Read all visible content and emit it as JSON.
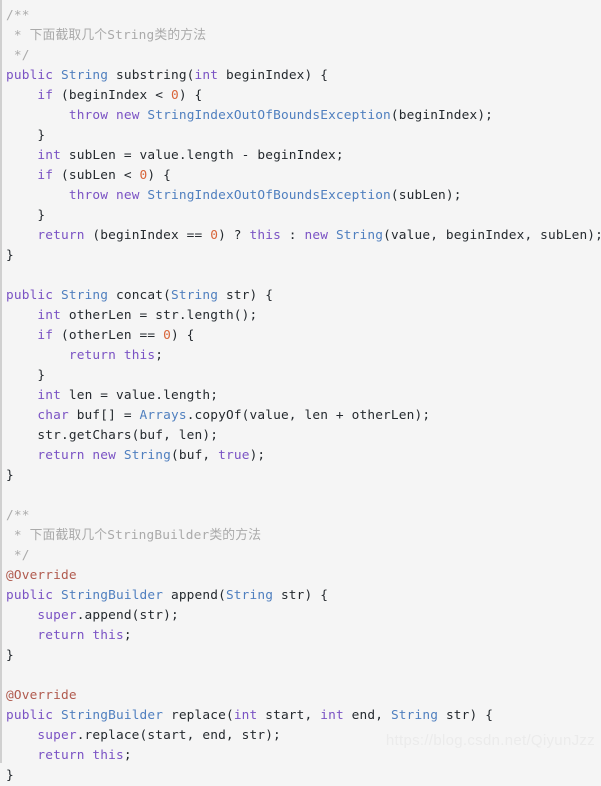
{
  "editor": {
    "language": "java",
    "background_color": "#f5f5f5",
    "colors": {
      "keyword": "#7a52c4",
      "type": "#4f7fbf",
      "annotation": "#b05a4e",
      "number": "#d8653a",
      "comment": "#aaaaaa",
      "plain": "#24292e"
    },
    "lines": [
      {
        "indent": 0,
        "tokens": [
          {
            "t": "/**",
            "c": "cmt"
          }
        ]
      },
      {
        "indent": 0,
        "tokens": [
          {
            "t": " * 下面截取几个String类的方法",
            "c": "cmt"
          }
        ]
      },
      {
        "indent": 0,
        "tokens": [
          {
            "t": " */",
            "c": "cmt"
          }
        ]
      },
      {
        "indent": 0,
        "tokens": [
          {
            "t": "public",
            "c": "kw"
          },
          {
            "t": " ",
            "c": "plain"
          },
          {
            "t": "String",
            "c": "type"
          },
          {
            "t": " substring(",
            "c": "plain"
          },
          {
            "t": "int",
            "c": "kw"
          },
          {
            "t": " beginIndex) {",
            "c": "plain"
          }
        ]
      },
      {
        "indent": 1,
        "tokens": [
          {
            "t": "if",
            "c": "kw"
          },
          {
            "t": " (beginIndex < ",
            "c": "plain"
          },
          {
            "t": "0",
            "c": "num"
          },
          {
            "t": ") {",
            "c": "plain"
          }
        ]
      },
      {
        "indent": 2,
        "tokens": [
          {
            "t": "throw",
            "c": "kw"
          },
          {
            "t": " ",
            "c": "plain"
          },
          {
            "t": "new",
            "c": "kw"
          },
          {
            "t": " ",
            "c": "plain"
          },
          {
            "t": "StringIndexOutOfBoundsException",
            "c": "type"
          },
          {
            "t": "(beginIndex);",
            "c": "plain"
          }
        ]
      },
      {
        "indent": 1,
        "tokens": [
          {
            "t": "}",
            "c": "plain"
          }
        ]
      },
      {
        "indent": 1,
        "tokens": [
          {
            "t": "int",
            "c": "kw"
          },
          {
            "t": " subLen = value.length - beginIndex;",
            "c": "plain"
          }
        ]
      },
      {
        "indent": 1,
        "tokens": [
          {
            "t": "if",
            "c": "kw"
          },
          {
            "t": " (subLen < ",
            "c": "plain"
          },
          {
            "t": "0",
            "c": "num"
          },
          {
            "t": ") {",
            "c": "plain"
          }
        ]
      },
      {
        "indent": 2,
        "tokens": [
          {
            "t": "throw",
            "c": "kw"
          },
          {
            "t": " ",
            "c": "plain"
          },
          {
            "t": "new",
            "c": "kw"
          },
          {
            "t": " ",
            "c": "plain"
          },
          {
            "t": "StringIndexOutOfBoundsException",
            "c": "type"
          },
          {
            "t": "(subLen);",
            "c": "plain"
          }
        ]
      },
      {
        "indent": 1,
        "tokens": [
          {
            "t": "}",
            "c": "plain"
          }
        ]
      },
      {
        "indent": 1,
        "tokens": [
          {
            "t": "return",
            "c": "kw"
          },
          {
            "t": " (beginIndex == ",
            "c": "plain"
          },
          {
            "t": "0",
            "c": "num"
          },
          {
            "t": ") ? ",
            "c": "plain"
          },
          {
            "t": "this",
            "c": "kw"
          },
          {
            "t": " : ",
            "c": "plain"
          },
          {
            "t": "new",
            "c": "kw"
          },
          {
            "t": " ",
            "c": "plain"
          },
          {
            "t": "String",
            "c": "type"
          },
          {
            "t": "(value, beginIndex, subLen);",
            "c": "plain"
          }
        ]
      },
      {
        "indent": 0,
        "tokens": [
          {
            "t": "}",
            "c": "plain"
          }
        ]
      },
      {
        "indent": 0,
        "tokens": [
          {
            "t": "",
            "c": "plain"
          }
        ]
      },
      {
        "indent": 0,
        "tokens": [
          {
            "t": "public",
            "c": "kw"
          },
          {
            "t": " ",
            "c": "plain"
          },
          {
            "t": "String",
            "c": "type"
          },
          {
            "t": " concat(",
            "c": "plain"
          },
          {
            "t": "String",
            "c": "type"
          },
          {
            "t": " str) {",
            "c": "plain"
          }
        ]
      },
      {
        "indent": 1,
        "tokens": [
          {
            "t": "int",
            "c": "kw"
          },
          {
            "t": " otherLen = str.length();",
            "c": "plain"
          }
        ]
      },
      {
        "indent": 1,
        "tokens": [
          {
            "t": "if",
            "c": "kw"
          },
          {
            "t": " (otherLen == ",
            "c": "plain"
          },
          {
            "t": "0",
            "c": "num"
          },
          {
            "t": ") {",
            "c": "plain"
          }
        ]
      },
      {
        "indent": 2,
        "tokens": [
          {
            "t": "return",
            "c": "kw"
          },
          {
            "t": " ",
            "c": "plain"
          },
          {
            "t": "this",
            "c": "kw"
          },
          {
            "t": ";",
            "c": "plain"
          }
        ]
      },
      {
        "indent": 1,
        "tokens": [
          {
            "t": "}",
            "c": "plain"
          }
        ]
      },
      {
        "indent": 1,
        "tokens": [
          {
            "t": "int",
            "c": "kw"
          },
          {
            "t": " len = value.length;",
            "c": "plain"
          }
        ]
      },
      {
        "indent": 1,
        "tokens": [
          {
            "t": "char",
            "c": "kw"
          },
          {
            "t": " buf[] = ",
            "c": "plain"
          },
          {
            "t": "Arrays",
            "c": "type"
          },
          {
            "t": ".copyOf(value, len + otherLen);",
            "c": "plain"
          }
        ]
      },
      {
        "indent": 1,
        "tokens": [
          {
            "t": "str.getChars(buf, len);",
            "c": "plain"
          }
        ]
      },
      {
        "indent": 1,
        "tokens": [
          {
            "t": "return",
            "c": "kw"
          },
          {
            "t": " ",
            "c": "plain"
          },
          {
            "t": "new",
            "c": "kw"
          },
          {
            "t": " ",
            "c": "plain"
          },
          {
            "t": "String",
            "c": "type"
          },
          {
            "t": "(buf, ",
            "c": "plain"
          },
          {
            "t": "true",
            "c": "kw"
          },
          {
            "t": ");",
            "c": "plain"
          }
        ]
      },
      {
        "indent": 0,
        "tokens": [
          {
            "t": "}",
            "c": "plain"
          }
        ]
      },
      {
        "indent": 0,
        "tokens": [
          {
            "t": "",
            "c": "plain"
          }
        ]
      },
      {
        "indent": 0,
        "tokens": [
          {
            "t": "/**",
            "c": "cmt"
          }
        ]
      },
      {
        "indent": 0,
        "tokens": [
          {
            "t": " * 下面截取几个StringBuilder类的方法",
            "c": "cmt"
          }
        ]
      },
      {
        "indent": 0,
        "tokens": [
          {
            "t": " */",
            "c": "cmt"
          }
        ]
      },
      {
        "indent": 0,
        "tokens": [
          {
            "t": "@Override",
            "c": "ann"
          }
        ]
      },
      {
        "indent": 0,
        "tokens": [
          {
            "t": "public",
            "c": "kw"
          },
          {
            "t": " ",
            "c": "plain"
          },
          {
            "t": "StringBuilder",
            "c": "type"
          },
          {
            "t": " append(",
            "c": "plain"
          },
          {
            "t": "String",
            "c": "type"
          },
          {
            "t": " str) {",
            "c": "plain"
          }
        ]
      },
      {
        "indent": 1,
        "tokens": [
          {
            "t": "super",
            "c": "kw"
          },
          {
            "t": ".append(str);",
            "c": "plain"
          }
        ]
      },
      {
        "indent": 1,
        "tokens": [
          {
            "t": "return",
            "c": "kw"
          },
          {
            "t": " ",
            "c": "plain"
          },
          {
            "t": "this",
            "c": "kw"
          },
          {
            "t": ";",
            "c": "plain"
          }
        ]
      },
      {
        "indent": 0,
        "tokens": [
          {
            "t": "}",
            "c": "plain"
          }
        ]
      },
      {
        "indent": 0,
        "tokens": [
          {
            "t": "",
            "c": "plain"
          }
        ]
      },
      {
        "indent": 0,
        "tokens": [
          {
            "t": "@Override",
            "c": "ann"
          }
        ]
      },
      {
        "indent": 0,
        "tokens": [
          {
            "t": "public",
            "c": "kw"
          },
          {
            "t": " ",
            "c": "plain"
          },
          {
            "t": "StringBuilder",
            "c": "type"
          },
          {
            "t": " replace(",
            "c": "plain"
          },
          {
            "t": "int",
            "c": "kw"
          },
          {
            "t": " start, ",
            "c": "plain"
          },
          {
            "t": "int",
            "c": "kw"
          },
          {
            "t": " end, ",
            "c": "plain"
          },
          {
            "t": "String",
            "c": "type"
          },
          {
            "t": " str) {",
            "c": "plain"
          }
        ]
      },
      {
        "indent": 1,
        "tokens": [
          {
            "t": "super",
            "c": "kw"
          },
          {
            "t": ".replace(start, end, str);",
            "c": "plain"
          }
        ]
      },
      {
        "indent": 1,
        "tokens": [
          {
            "t": "return",
            "c": "kw"
          },
          {
            "t": " ",
            "c": "plain"
          },
          {
            "t": "this",
            "c": "kw"
          },
          {
            "t": ";",
            "c": "plain"
          }
        ]
      },
      {
        "indent": 0,
        "tokens": [
          {
            "t": "}",
            "c": "plain"
          }
        ]
      }
    ]
  },
  "watermark": {
    "text": "https://blog.csdn.net/QiyunJzz"
  }
}
